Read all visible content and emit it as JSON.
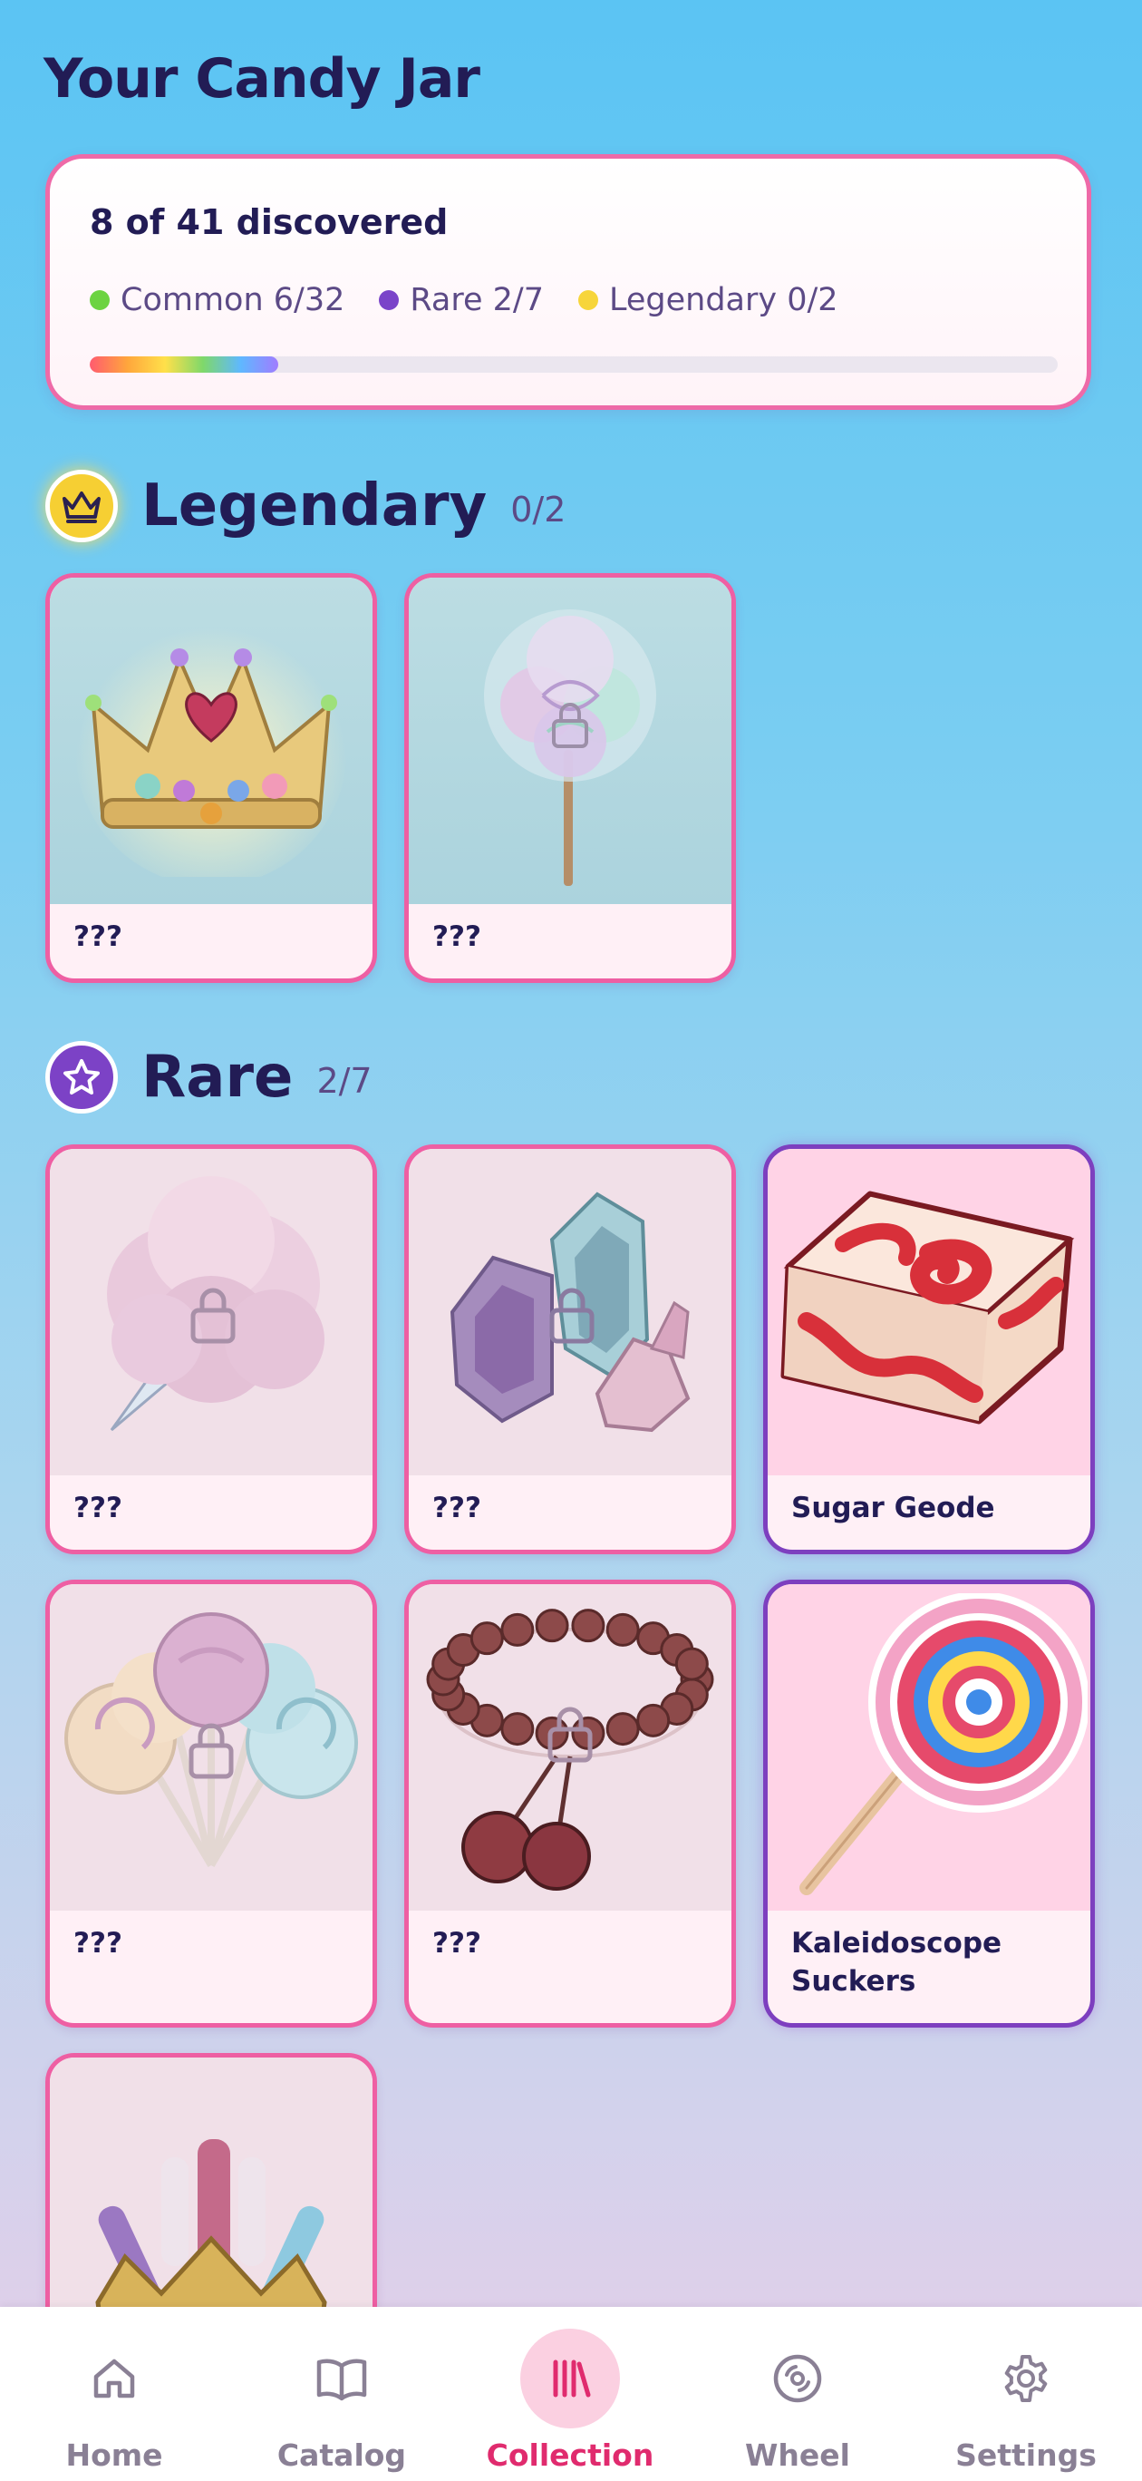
{
  "header": {
    "title": "Your Candy Jar"
  },
  "summary": {
    "discovered": "8 of 41 discovered",
    "progress_fraction": 0.195,
    "tiers": [
      {
        "label": "Common 6/32",
        "color": "#6cd341"
      },
      {
        "label": "Rare 2/7",
        "color": "#7a44c9"
      },
      {
        "label": "Legendary 0/2",
        "color": "#f7d53a"
      }
    ]
  },
  "sections": {
    "legendary": {
      "title": "Legendary",
      "count": "0/2",
      "icon": "crown-icon",
      "items": [
        {
          "label": "???",
          "art": "jeweled-crown",
          "locked": true
        },
        {
          "label": "???",
          "art": "swirl-cotton-candy",
          "locked": true
        }
      ]
    },
    "rare": {
      "title": "Rare",
      "count": "2/7",
      "icon": "star-icon",
      "items": [
        {
          "label": "???",
          "art": "cotton-candy-cloud",
          "locked": true
        },
        {
          "label": "???",
          "art": "crystal-geodes",
          "locked": true
        },
        {
          "label": "Sugar Geode",
          "art": "swirl-taffy-cube",
          "locked": false
        },
        {
          "label": "???",
          "art": "lollipop-bouquet",
          "locked": true
        },
        {
          "label": "???",
          "art": "candy-bead-bracelet",
          "locked": true
        },
        {
          "label": "Kaleidoscope Suckers",
          "art": "rainbow-lollipop",
          "locked": false
        },
        {
          "label": "",
          "art": "rock-candy-crown",
          "locked": true
        }
      ]
    }
  },
  "nav": {
    "items": [
      {
        "label": "Home",
        "icon": "home-icon"
      },
      {
        "label": "Catalog",
        "icon": "book-icon"
      },
      {
        "label": "Collection",
        "icon": "library-icon",
        "active": true
      },
      {
        "label": "Wheel",
        "icon": "wheel-icon"
      },
      {
        "label": "Settings",
        "icon": "gear-icon"
      }
    ]
  }
}
